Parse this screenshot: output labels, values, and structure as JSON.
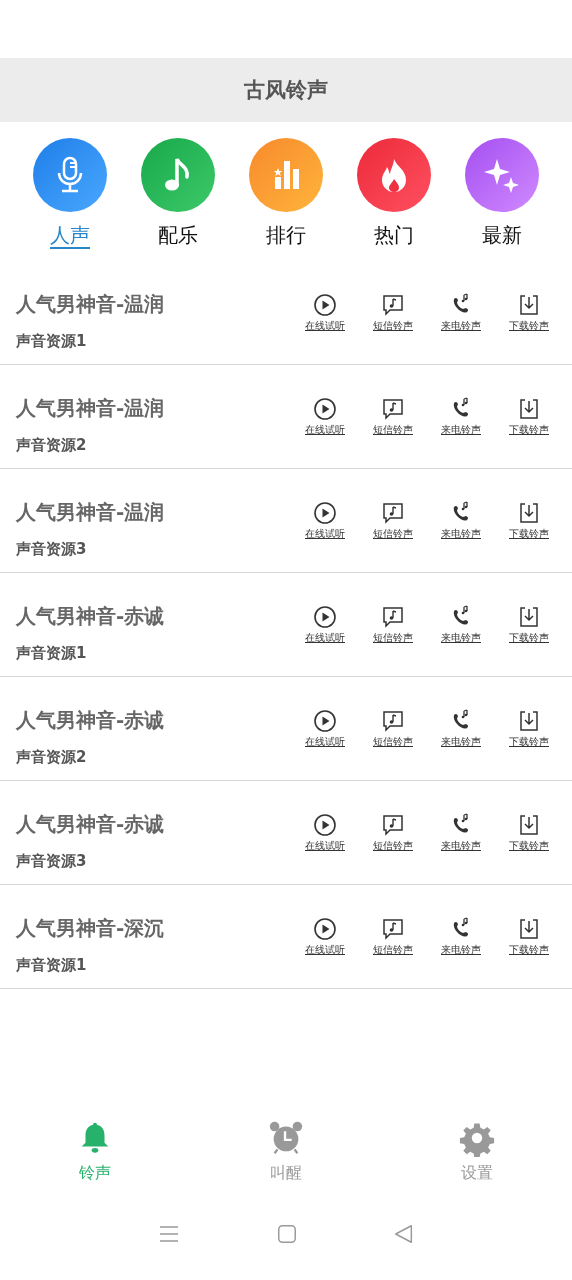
{
  "header": {
    "title": "古风铃声"
  },
  "categories": [
    {
      "kind": "mic",
      "label": "人声",
      "selected": true
    },
    {
      "kind": "note",
      "label": "配乐",
      "selected": false
    },
    {
      "kind": "chart",
      "label": "排行",
      "selected": false
    },
    {
      "kind": "fire",
      "label": "热门",
      "selected": false
    },
    {
      "kind": "sparkle",
      "label": "最新",
      "selected": false
    }
  ],
  "rows": [
    {
      "title": "人气男神音-温润",
      "subtitle": "声音资源1",
      "actions": [
        {
          "kind": "play",
          "label": "在线试听"
        },
        {
          "kind": "sms",
          "label": "短信铃声"
        },
        {
          "kind": "call",
          "label": "来电铃声"
        },
        {
          "kind": "download",
          "label": "下载铃声"
        }
      ]
    },
    {
      "title": "人气男神音-温润",
      "subtitle": "声音资源2",
      "actions": [
        {
          "kind": "play",
          "label": "在线试听"
        },
        {
          "kind": "sms",
          "label": "短信铃声"
        },
        {
          "kind": "call",
          "label": "来电铃声"
        },
        {
          "kind": "download",
          "label": "下载铃声"
        }
      ]
    },
    {
      "title": "人气男神音-温润",
      "subtitle": "声音资源3",
      "actions": [
        {
          "kind": "play",
          "label": "在线试听"
        },
        {
          "kind": "sms",
          "label": "短信铃声"
        },
        {
          "kind": "call",
          "label": "来电铃声"
        },
        {
          "kind": "download",
          "label": "下载铃声"
        }
      ]
    },
    {
      "title": "人气男神音-赤诚",
      "subtitle": "声音资源1",
      "actions": [
        {
          "kind": "play",
          "label": "在线试听"
        },
        {
          "kind": "sms",
          "label": "短信铃声"
        },
        {
          "kind": "call",
          "label": "来电铃声"
        },
        {
          "kind": "download",
          "label": "下载铃声"
        }
      ]
    },
    {
      "title": "人气男神音-赤诚",
      "subtitle": "声音资源2",
      "actions": [
        {
          "kind": "play",
          "label": "在线试听"
        },
        {
          "kind": "sms",
          "label": "短信铃声"
        },
        {
          "kind": "call",
          "label": "来电铃声"
        },
        {
          "kind": "download",
          "label": "下载铃声"
        }
      ]
    },
    {
      "title": "人气男神音-赤诚",
      "subtitle": "声音资源3",
      "actions": [
        {
          "kind": "play",
          "label": "在线试听"
        },
        {
          "kind": "sms",
          "label": "短信铃声"
        },
        {
          "kind": "call",
          "label": "来电铃声"
        },
        {
          "kind": "download",
          "label": "下载铃声"
        }
      ]
    },
    {
      "title": "人气男神音-深沉",
      "subtitle": "声音资源1",
      "actions": [
        {
          "kind": "play",
          "label": "在线试听"
        },
        {
          "kind": "sms",
          "label": "短信铃声"
        },
        {
          "kind": "call",
          "label": "来电铃声"
        },
        {
          "kind": "download",
          "label": "下载铃声"
        }
      ]
    }
  ],
  "bottom_nav": [
    {
      "kind": "bell",
      "label": "铃声",
      "selected": true
    },
    {
      "kind": "alarm",
      "label": "叫醒",
      "selected": false
    },
    {
      "kind": "gear",
      "label": "设置",
      "selected": false
    }
  ]
}
